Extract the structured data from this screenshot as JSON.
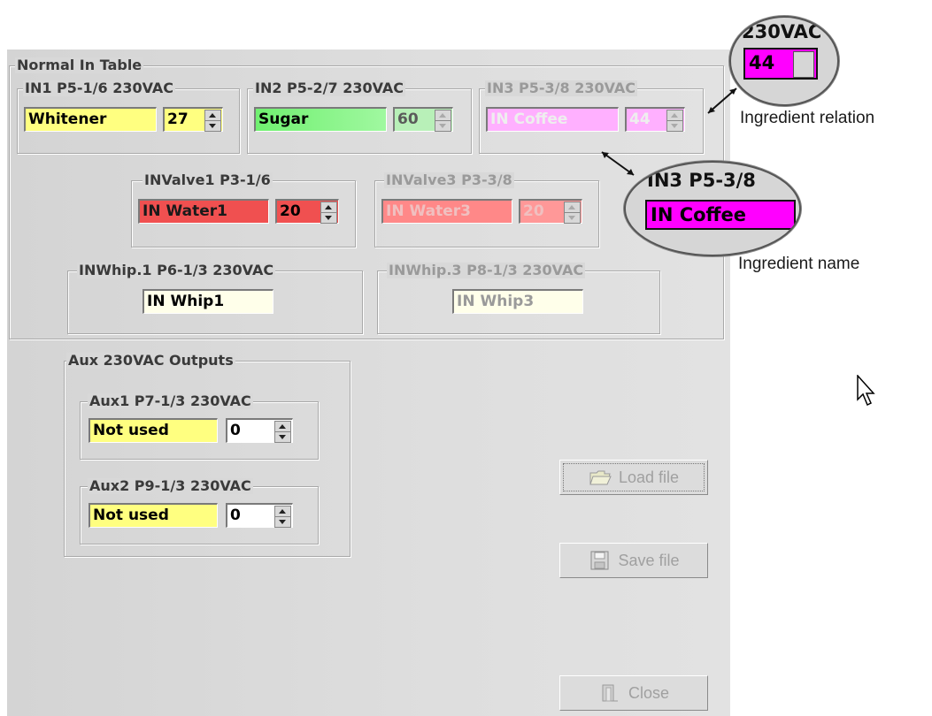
{
  "normal_table": {
    "title": "Normal In Table",
    "in1": {
      "legend": "IN1 P5-1/6 230VAC",
      "name": "Whitener",
      "value": "27",
      "color": "#ffff80"
    },
    "in2": {
      "legend": "IN2 P5-2/7 230VAC",
      "name": "Sugar",
      "value": "60",
      "color": "#80ff80"
    },
    "in3": {
      "legend": "IN3 P5-3/8 230VAC",
      "name": "IN Coffee",
      "value": "44",
      "color": "#ff80ff"
    },
    "valve1": {
      "legend": "INValve1 P3-1/6",
      "name": "IN Water1",
      "value": "20",
      "color": "#ff6060"
    },
    "valve3": {
      "legend": "INValve3 P3-3/8",
      "name": "IN Water3",
      "value": "20",
      "color": "#ff8080"
    },
    "whip1": {
      "legend": "INWhip.1 P6-1/3 230VAC",
      "name": "IN Whip1",
      "color": "#ffffe8"
    },
    "whip3": {
      "legend": "INWhip.3 P8-1/3 230VAC",
      "name": "IN Whip3",
      "color": "#ffffe8"
    }
  },
  "aux": {
    "title": "Aux 230VAC Outputs",
    "aux1": {
      "legend": "Aux1 P7-1/3 230VAC",
      "name": "Not used",
      "value": "0"
    },
    "aux2": {
      "legend": "Aux2 P9-1/3 230VAC",
      "name": "Not used",
      "value": "0"
    }
  },
  "buttons": {
    "load": "Load file",
    "save": "Save file",
    "close": "Close"
  },
  "callouts": {
    "relation_label": "Ingredient relation",
    "name_label": "Ingredient name",
    "lens1_legend": "230VAC",
    "lens1_value": "44",
    "lens2_legend": "IN3 P5-3/8",
    "lens2_value": "IN Coffee",
    "highlight_color": "#ff00ff"
  }
}
